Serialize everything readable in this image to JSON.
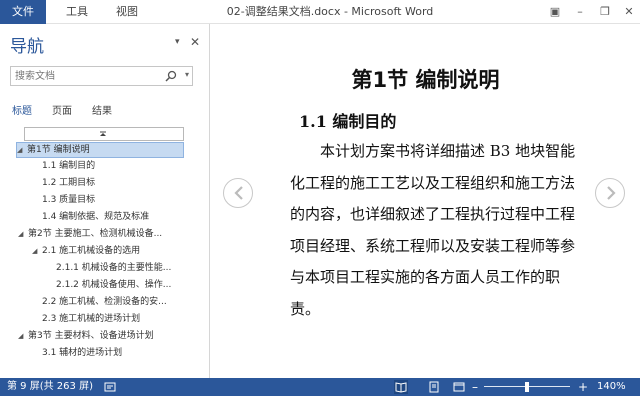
{
  "titlebar": {
    "file_label": "文件",
    "menus": [
      "工具",
      "视图"
    ],
    "doc_title": "02-调整结果文档.docx - Microsoft Word",
    "buttons": {
      "ribbon": "▣",
      "minimize": "–",
      "restore": "❐",
      "close": "✕"
    }
  },
  "nav": {
    "title": "导航",
    "options_caret": "▾",
    "close": "✕",
    "search_placeholder": "搜索文档",
    "tabs": [
      {
        "label": "标题",
        "active": true
      },
      {
        "label": "页面",
        "active": false
      },
      {
        "label": "结果",
        "active": false
      }
    ],
    "tree": [
      {
        "label": "第1节  编制说明",
        "level": 0,
        "expanded": true,
        "selected": true
      },
      {
        "label": "1.1 编制目的",
        "level": 1
      },
      {
        "label": "1.2 工期目标",
        "level": 1
      },
      {
        "label": "1.3 质量目标",
        "level": 1
      },
      {
        "label": "1.4 编制依据、规范及标准",
        "level": 1
      },
      {
        "label": "第2节  主要施工、检测机械设备...",
        "level": 0,
        "expanded": true
      },
      {
        "label": "2.1 施工机械设备的选用",
        "level": 1,
        "expanded": true
      },
      {
        "label": "2.1.1 机械设备的主要性能...",
        "level": 2
      },
      {
        "label": "2.1.2 机械设备使用、操作...",
        "level": 2
      },
      {
        "label": "2.2 施工机械、检测设备的安...",
        "level": 1
      },
      {
        "label": "2.3 施工机械的进场计划",
        "level": 1
      },
      {
        "label": "第3节  主要材料、设备进场计划",
        "level": 0,
        "expanded": true
      },
      {
        "label": "3.1 辅材的进场计划",
        "level": 1
      }
    ]
  },
  "document": {
    "heading1": "第1节  编制说明",
    "heading2": "1.1 编制目的",
    "paragraph": "本计划方案书将详细描述 B3 地块智能化工程的施工工艺以及工程组织和施工方法的内容，也详细叙述了工程执行过程中工程项目经理、系统工程师以及安装工程师等参与本项目工程实施的各方面人员工作的职责。"
  },
  "status": {
    "page_info": "第 9 屏(共 263 屏)",
    "zoom_minus": "–",
    "zoom_plus": "+",
    "zoom_level": "140%",
    "zoom_fraction": 0.5
  },
  "colors": {
    "accent": "#2b579a",
    "selection": "#c6daf1"
  }
}
